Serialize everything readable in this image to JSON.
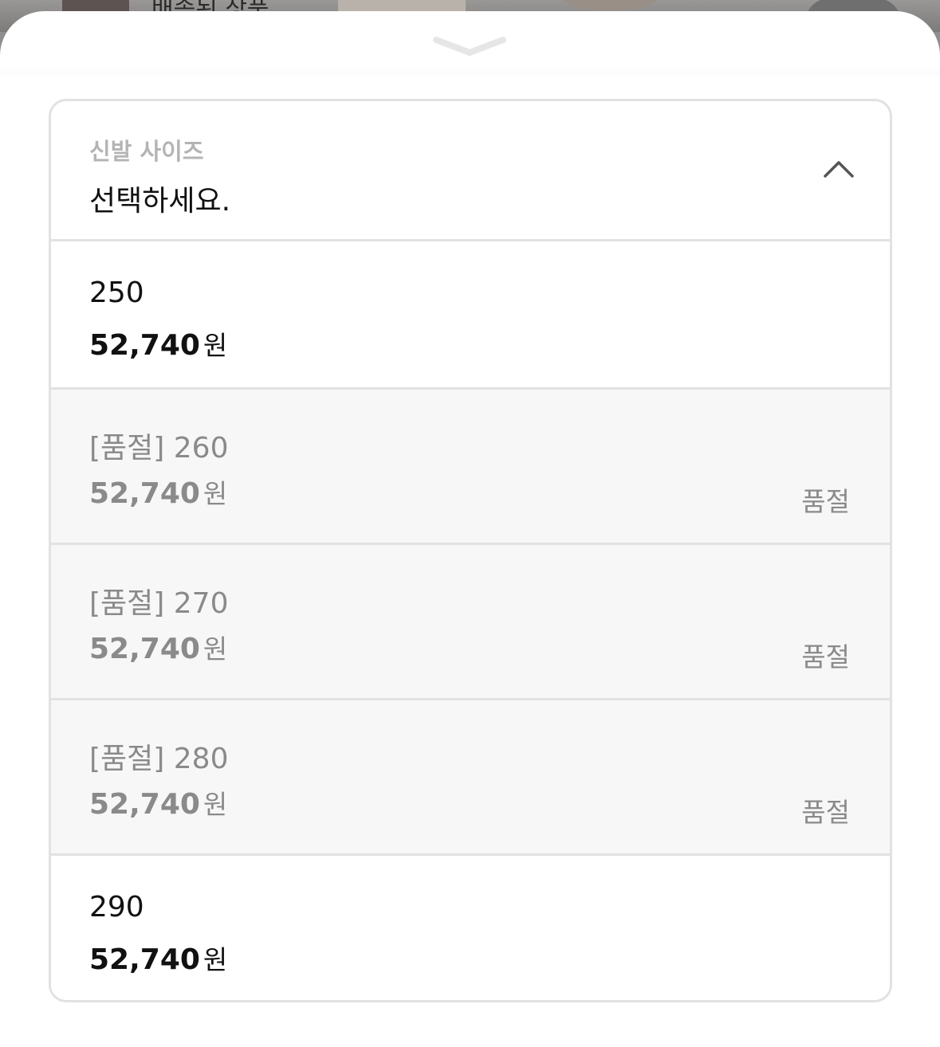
{
  "background": {
    "partial_title": "배송된 상품"
  },
  "sheet": {
    "handle_icon": "chevron-down-icon"
  },
  "size_select": {
    "label": "신발 사이즈",
    "value": "선택하세요.",
    "toggle_icon": "chevron-up-icon",
    "options": [
      {
        "name": "250",
        "price": "52,740",
        "unit": "원",
        "status": ""
      },
      {
        "name": "[품절] 260",
        "price": "52,740",
        "unit": "원",
        "status": "품절"
      },
      {
        "name": "[품절] 270",
        "price": "52,740",
        "unit": "원",
        "status": "품절"
      },
      {
        "name": "[품절] 280",
        "price": "52,740",
        "unit": "원",
        "status": "품절"
      },
      {
        "name": "290",
        "price": "52,740",
        "unit": "원",
        "status": ""
      }
    ]
  },
  "colors": {
    "border": "#e2e2e2",
    "soldout_bg": "#f7f7f7",
    "text": "#111111",
    "muted": "#8a8a8a"
  }
}
